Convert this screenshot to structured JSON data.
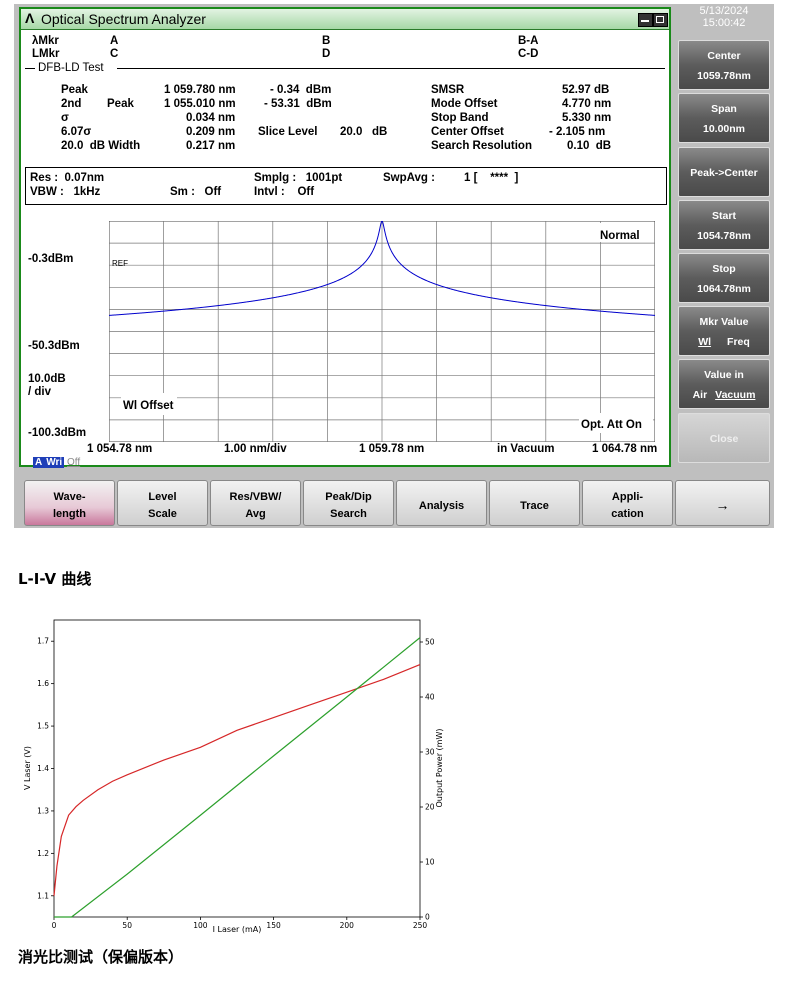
{
  "window": {
    "title": "Optical Spectrum Analyzer",
    "date": "5/13/2024",
    "time": "15:00:42"
  },
  "markers": {
    "lambda_mkr": "λMkr",
    "l_mkr": "LMkr",
    "a": "A",
    "b": "B",
    "c": "C",
    "d": "D",
    "b_a": "B-A",
    "c_d": "C-D"
  },
  "test": {
    "section_label": "DFB-LD Test",
    "peak_label": "Peak",
    "peak_wl": "1 059.780 nm",
    "peak_level": "- 0.34  dBm",
    "second_label": "2nd",
    "second_sub": "Peak",
    "second_wl": "1 055.010 nm",
    "second_level": "- 53.31  dBm",
    "sigma_label": "σ",
    "sigma_val": "0.034 nm",
    "sigma6_label": "6.07σ",
    "sigma6_val": "0.209 nm",
    "slice_label": "Slice Level",
    "slice_val": "20.0   dB",
    "width_label": "20.0  dB Width",
    "width_val": "0.217 nm",
    "smsr_label": "SMSR",
    "smsr_val": "52.97 dB",
    "mode_offset_label": "Mode Offset",
    "mode_offset_val": "4.770 nm",
    "stop_band_label": "Stop Band",
    "stop_band_val": "5.330 nm",
    "center_offset_label": "Center Offset",
    "center_offset_val": "- 2.105 nm",
    "search_res_label": "Search Resolution",
    "search_res_val": "0.10  dB"
  },
  "conditions": {
    "res": "Res :  0.07nm",
    "vbw": "VBW :   1kHz",
    "sm": "Sm :   Off",
    "smplg": "Smplg :   1001pt",
    "intvl": "Intvl :    Off",
    "swpavg_label": "SwpAvg :",
    "swpavg_val": "1 [    ****  ]"
  },
  "spectrum": {
    "mode": "Normal",
    "ref_tag": "REF",
    "ref_level": "-0.3dBm",
    "mid_level": "-50.3dBm",
    "scale": "10.0dB",
    "scale_unit": "/ div",
    "bottom_level": "-100.3dBm",
    "wl_offset": "Wl Offset",
    "opt_att": "Opt. Att On",
    "x_start": "1 054.78 nm",
    "x_div": "1.00 nm/div",
    "x_center": "1 059.78 nm",
    "x_medium": "in Vacuum",
    "x_stop": "1 064.78 nm",
    "trace_tag": "A",
    "trace_write": "Wri",
    "trace_state": "Off",
    "trace_color": "#0000cc"
  },
  "softkeys": [
    {
      "l1": "Center",
      "l2": "1059.78nm"
    },
    {
      "l1": "Span",
      "l2": "10.00nm"
    },
    {
      "l1": "Peak->Center",
      "l2": ""
    },
    {
      "l1": "Start",
      "l2": "1054.78nm"
    },
    {
      "l1": "Stop",
      "l2": "1064.78nm"
    },
    {
      "l1": "Mkr Value",
      "l2a": "Wl",
      "l2b": "Freq"
    },
    {
      "l1": "Value in",
      "l2a": "Air",
      "l2b": "Vacuum"
    },
    {
      "l1": "Close",
      "l2": ""
    }
  ],
  "bottom_keys": [
    {
      "l1": "Wave-",
      "l2": "length"
    },
    {
      "l1": "Level",
      "l2": "Scale"
    },
    {
      "l1": "Res/VBW/",
      "l2": "Avg"
    },
    {
      "l1": "Peak/Dip",
      "l2": "Search"
    },
    {
      "l1": "Analysis",
      "l2": ""
    },
    {
      "l1": "Trace",
      "l2": ""
    },
    {
      "l1": "Appli-",
      "l2": "cation"
    },
    {
      "l1": "→",
      "l2": ""
    }
  ],
  "liv_heading": "L-I-V 曲线",
  "extinction_heading": "消光比测试（保偏版本）",
  "chart_data": {
    "type": "line",
    "xlabel": "I Laser (mA)",
    "ylabel": "V Laser (V)",
    "y2label": "Output Power (mW)",
    "xlim": [
      0,
      250
    ],
    "ylim": [
      1.05,
      1.75
    ],
    "y2lim": [
      0,
      54
    ],
    "x_ticks": [
      "0",
      "50",
      "100",
      "150",
      "200",
      "250"
    ],
    "y_ticks": [
      "1.1",
      "1.2",
      "1.3",
      "1.4",
      "1.5",
      "1.6",
      "1.7"
    ],
    "y2_ticks": [
      "0",
      "10",
      "20",
      "30",
      "40",
      "50"
    ],
    "series": [
      {
        "axis": "left",
        "color": "#d62728",
        "x": [
          0,
          2,
          5,
          10,
          15,
          20,
          30,
          40,
          50,
          75,
          100,
          125,
          150,
          175,
          200,
          225,
          250
        ],
        "values": [
          1.1,
          1.17,
          1.24,
          1.29,
          1.31,
          1.325,
          1.35,
          1.37,
          1.385,
          1.42,
          1.45,
          1.49,
          1.52,
          1.55,
          1.58,
          1.61,
          1.645
        ]
      },
      {
        "axis": "right",
        "color": "#2ca02c",
        "x": [
          0,
          12,
          50,
          100,
          150,
          200,
          250
        ],
        "values": [
          0,
          0,
          7.8,
          18.5,
          29.3,
          40.0,
          50.8
        ]
      }
    ]
  }
}
